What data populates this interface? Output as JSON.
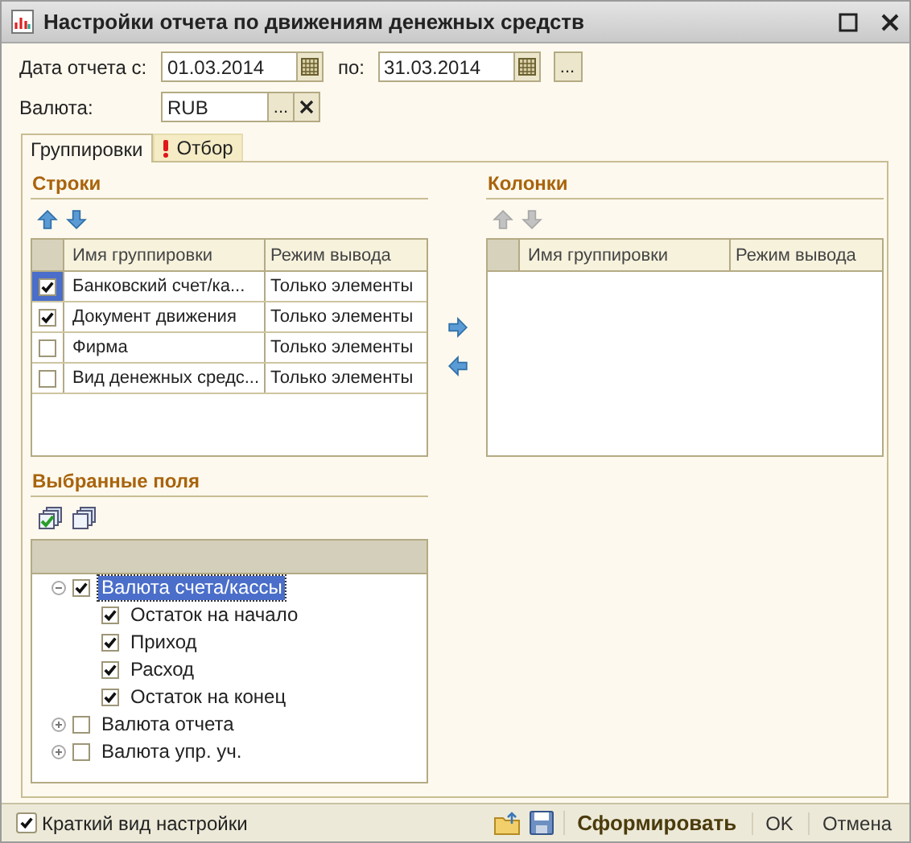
{
  "window": {
    "title": "Настройки отчета по движениям денежных средств"
  },
  "date_from": {
    "label": "Дата отчета с:",
    "value": "01.03.2014"
  },
  "date_to": {
    "label": "по:",
    "value": "31.03.2014"
  },
  "period_button": "...",
  "currency": {
    "label": "Валюта:",
    "value": "RUB",
    "select_button": "..."
  },
  "tabs": [
    {
      "label": "Группировки",
      "selected": true,
      "warning": false
    },
    {
      "label": "Отбор",
      "selected": false,
      "warning": true
    }
  ],
  "rows_section": {
    "title": "Строки",
    "move_disabled": false,
    "columns": [
      "Имя группировки",
      "Режим вывода"
    ],
    "rows": [
      {
        "name": "Банковский счет/ка...",
        "mode": "Только элементы",
        "checked": true,
        "selected": true
      },
      {
        "name": "Документ движения",
        "mode": "Только элементы",
        "checked": true,
        "selected": false
      },
      {
        "name": "Фирма",
        "mode": "Только элементы",
        "checked": false,
        "selected": false
      },
      {
        "name": "Вид денежных средс...",
        "mode": "Только элементы",
        "checked": false,
        "selected": false
      }
    ]
  },
  "columns_section": {
    "title": "Колонки",
    "move_disabled": true,
    "columns": [
      "Имя группировки",
      "Режим вывода"
    ]
  },
  "selected_fields": {
    "title": "Выбранные поля",
    "tree": [
      {
        "label": "Валюта счета/кассы",
        "checked": true,
        "expanded": true,
        "selected": true,
        "children": [
          {
            "label": "Остаток на начало",
            "checked": true,
            "selected": false
          },
          {
            "label": "Приход",
            "checked": true,
            "selected": false
          },
          {
            "label": "Расход",
            "checked": true,
            "selected": false
          },
          {
            "label": "Остаток на конец",
            "checked": true,
            "selected": false
          }
        ]
      },
      {
        "label": "Валюта отчета",
        "checked": false,
        "expanded": false,
        "selected": false
      },
      {
        "label": "Валюта упр. уч.",
        "checked": false,
        "expanded": false,
        "selected": false
      }
    ]
  },
  "footer": {
    "short_view": {
      "label": "Краткий вид настройки",
      "checked": true
    },
    "generate": "Сформировать",
    "ok": "OK",
    "cancel": "Отмена"
  }
}
